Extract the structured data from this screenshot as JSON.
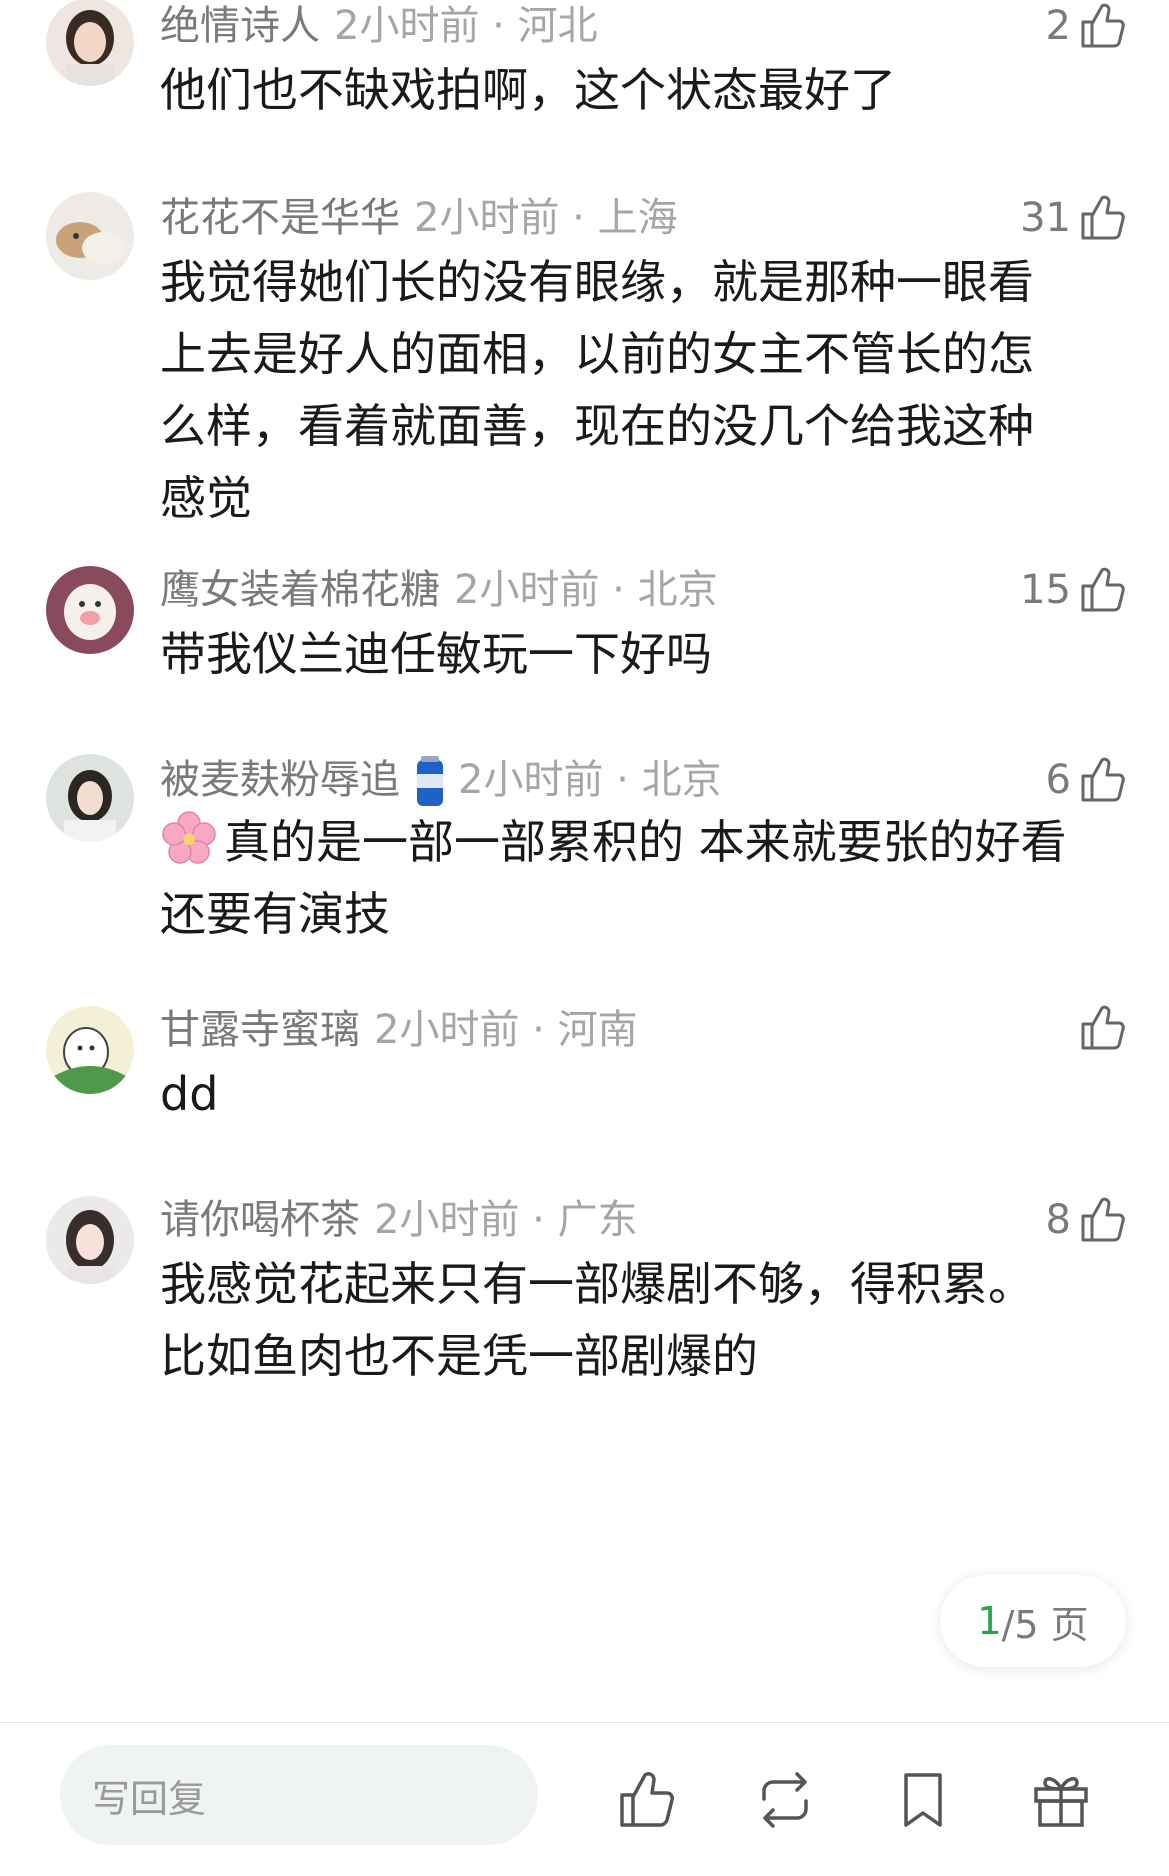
{
  "comments": [
    {
      "name": "绝情诗人",
      "time": "2小时前 · 河北",
      "likes": "2",
      "lines": [
        "他们也不缺戏拍啊，这个状态最好了"
      ]
    },
    {
      "name": "花花不是华华",
      "time": "2小时前 · 上海",
      "likes": "31",
      "lines": [
        "我觉得她们长的没有眼缘，就是那种一眼看",
        "上去是好人的面相，以前的女主不管长的怎",
        "么样，看着就面善，现在的没几个给我这种",
        "感觉"
      ]
    },
    {
      "name": "鹰女装着棉花糖",
      "time": "2小时前 · 北京",
      "likes": "15",
      "lines": [
        "带我仪兰迪任敏玩一下好吗"
      ]
    },
    {
      "name": "被麦麸粉辱追",
      "time": "2小时前 · 北京",
      "likes": "6",
      "lines": [
        "真的是一部一部累积的 本来就要张的好看",
        "还要有演技"
      ]
    },
    {
      "name": "甘露寺蜜璃",
      "time": "2小时前 · 河南",
      "likes": "",
      "lines": [
        "dd"
      ]
    },
    {
      "name": "请你喝杯茶",
      "time": "2小时前 · 广东",
      "likes": "8",
      "lines": [
        "我感觉花起来只有一部爆剧不够，得积累。",
        "比如鱼肉也不是凭一部剧爆的"
      ]
    }
  ],
  "pager": {
    "current": "1",
    "total": "/5 页"
  },
  "bottom": {
    "reply_placeholder": "写回复"
  },
  "icons": {
    "like": "thumbs-up-icon",
    "repost": "repost-icon",
    "bookmark": "bookmark-icon",
    "gift": "gift-icon",
    "flower": "cherry-blossom-emoji",
    "badge": "beverage-can-badge"
  },
  "colors": {
    "meta": "#7a7a7a",
    "time": "#a6a6a6",
    "accent_green": "#22a84b",
    "reply_bg": "#f0f4f0"
  }
}
